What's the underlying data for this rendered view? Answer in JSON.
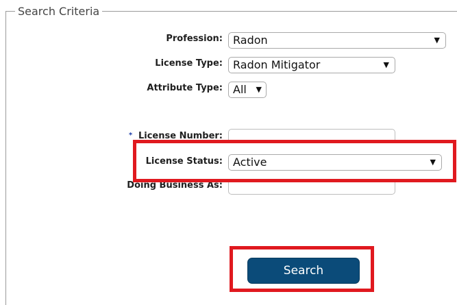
{
  "form": {
    "legend": "Search Criteria",
    "fields": {
      "profession": {
        "label": "Profession:",
        "value": "Radon"
      },
      "license_type": {
        "label": "License Type:",
        "value": "Radon Mitigator"
      },
      "attribute_type": {
        "label": "Attribute Type:",
        "value": "All"
      },
      "license_number": {
        "label": "License Number:",
        "required_marker": "*",
        "value": ""
      },
      "license_status": {
        "label": "License Status:",
        "value": "Active"
      },
      "doing_business_as": {
        "label": "Doing Business As:",
        "value": ""
      }
    },
    "search_button": "Search"
  },
  "icons": {
    "dropdown": "chevron-down-icon"
  },
  "colors": {
    "highlight": "#e0191f",
    "button_bg": "#0b4b79",
    "required_marker": "#1e3ea8"
  }
}
